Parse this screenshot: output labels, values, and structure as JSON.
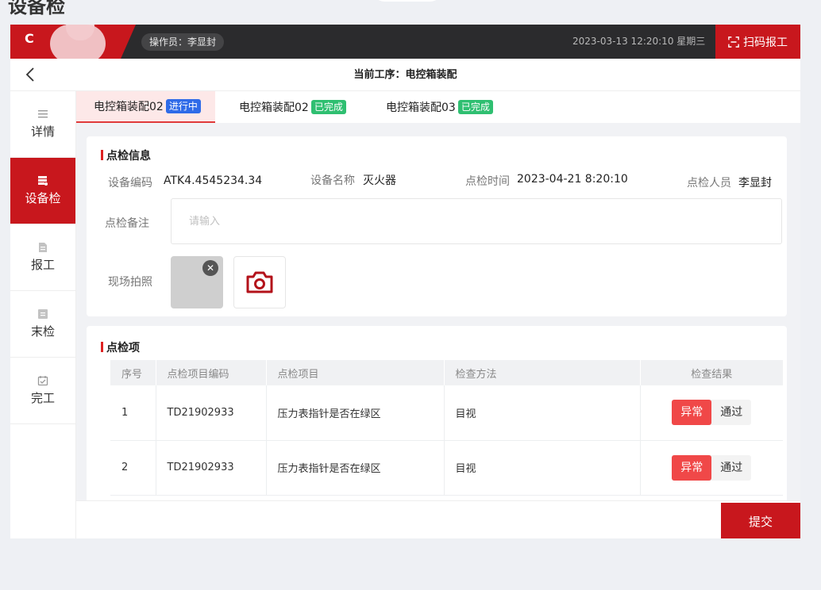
{
  "page": {
    "title": "设备检"
  },
  "topbar": {
    "logo_letter": "C",
    "operator": "操作员：李显封",
    "datetime": "2023-03-13 12:20:10 星期三",
    "scan_label": "扫码报工",
    "accent_color": "#c8171d"
  },
  "subheader": {
    "current_process": "当前工序：电控箱装配"
  },
  "sidebar": {
    "items": [
      {
        "label": "详情",
        "icon": "list-icon"
      },
      {
        "label": "设备检",
        "icon": "device-check-icon"
      },
      {
        "label": "报工",
        "icon": "report-icon"
      },
      {
        "label": "末检",
        "icon": "final-check-icon"
      },
      {
        "label": "完工",
        "icon": "complete-icon"
      }
    ]
  },
  "tabs": [
    {
      "label": "电控箱装配02",
      "status": "进行中",
      "status_color": "#2f6be8"
    },
    {
      "label": "电控箱装配02",
      "status": "已完成",
      "status_color": "#2fbf71"
    },
    {
      "label": "电控箱装配03",
      "status": "已完成",
      "status_color": "#2fbf71"
    }
  ],
  "inspection_info": {
    "title": "点检信息",
    "device_code_label": "设备编码",
    "device_code": "ATK4.4545234.34",
    "device_name_label": "设备名称",
    "device_name": "灭火器",
    "time_label": "点检时间",
    "time": "2023-04-21 8:20:10",
    "person_label": "点检人员",
    "person": "李显封",
    "remark_label": "点检备注",
    "remark_placeholder": "请输入",
    "photo_label": "现场拍照"
  },
  "inspection_items": {
    "title": "点检项",
    "headers": [
      "序号",
      "点检项目编码",
      "点检项目",
      "检查方法",
      "检查结果"
    ],
    "rows": [
      {
        "no": "1",
        "code": "TD21902933",
        "item": "压力表指针是否在绿区",
        "method": "目视",
        "abnormal": "异常",
        "pass": "通过"
      },
      {
        "no": "2",
        "code": "TD21902933",
        "item": "压力表指针是否在绿区",
        "method": "目视",
        "abnormal": "异常",
        "pass": "通过"
      }
    ]
  },
  "footer": {
    "submit_label": "提交"
  }
}
